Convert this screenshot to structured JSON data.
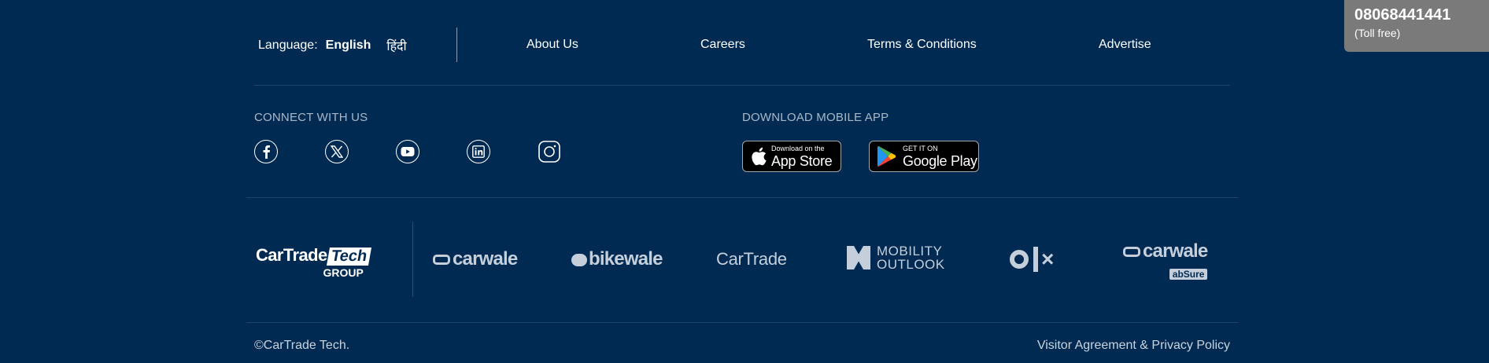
{
  "language": {
    "label": "Language:",
    "options": [
      "English",
      "हिंदी"
    ],
    "selected": "English"
  },
  "nav_links": [
    "About Us",
    "Careers",
    "Terms & Conditions",
    "Advertise"
  ],
  "connect": {
    "title": "CONNECT WITH US",
    "icons": [
      "facebook-icon",
      "x-icon",
      "youtube-icon",
      "linkedin-icon",
      "instagram-icon"
    ]
  },
  "download": {
    "title": "DOWNLOAD MOBILE APP",
    "app_store": {
      "small": "Download on the",
      "big": "App Store"
    },
    "google_play": {
      "small": "GET IT ON",
      "big": "Google Play"
    }
  },
  "group_logo": {
    "main1": "CarTrade",
    "main2": "Tech",
    "sub": "GROUP"
  },
  "brands": {
    "carwale": "carwale",
    "bikewale": "bikewale",
    "cartrade": "CarTrade",
    "mobility_line1": "MOBILITY",
    "mobility_line2": "OUTLOOK",
    "olx": "OLX",
    "carwale_absure": "carwale",
    "absure": "abSure"
  },
  "footer": {
    "copyright": "©CarTrade Tech.",
    "legal": "Visitor Agreement & Privacy Policy"
  },
  "callbox": {
    "number": "08068441441",
    "note": "(Toll free)"
  },
  "colors": {
    "background": "#002a52",
    "muted_text": "#a9b8c9",
    "callbox": "#7a7a7a"
  }
}
